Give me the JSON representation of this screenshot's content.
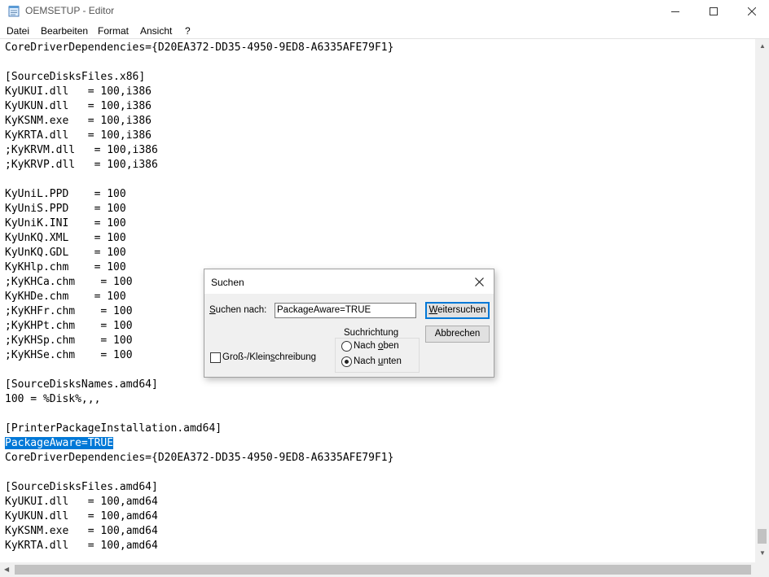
{
  "window": {
    "title": "OEMSETUP - Editor"
  },
  "menu": {
    "items": [
      "Datei",
      "Bearbeiten",
      "Format",
      "Ansicht",
      "?"
    ]
  },
  "editor": {
    "lines": [
      "CoreDriverDependencies={D20EA372-DD35-4950-9ED8-A6335AFE79F1}",
      "",
      "[SourceDisksFiles.x86]",
      "KyUKUI.dll   = 100,i386",
      "KyUKUN.dll   = 100,i386",
      "KyKSNM.exe   = 100,i386",
      "KyKRTA.dll   = 100,i386",
      ";KyKRVM.dll   = 100,i386",
      ";KyKRVP.dll   = 100,i386",
      "",
      "KyUniL.PPD    = 100",
      "KyUniS.PPD    = 100",
      "KyUniK.INI    = 100",
      "KyUnKQ.XML    = 100",
      "KyUnKQ.GDL    = 100",
      "KyKHlp.chm    = 100",
      ";KyKHCa.chm    = 100",
      "KyKHDe.chm    = 100",
      ";KyKHFr.chm    = 100",
      ";KyKHPt.chm    = 100",
      ";KyKHSp.chm    = 100",
      ";KyKHSe.chm    = 100",
      "",
      "[SourceDisksNames.amd64]",
      "100 = %Disk%,,,",
      "",
      "[PrinterPackageInstallation.amd64]",
      "PackageAware=TRUE",
      "CoreDriverDependencies={D20EA372-DD35-4950-9ED8-A6335AFE79F1}",
      "",
      "[SourceDisksFiles.amd64]",
      "KyUKUI.dll   = 100,amd64",
      "KyUKUN.dll   = 100,amd64",
      "KyKSNM.exe   = 100,amd64",
      "KyKRTA.dll   = 100,amd64"
    ],
    "selected_text": "PackageAware=TRUE",
    "selected_line_index": 27,
    "selection_color": "#0078d7"
  },
  "find_dialog": {
    "title": "Suchen",
    "search_label_prefix": "S",
    "search_label_rest": "uchen nach:",
    "search_value": "PackageAware=TRUE",
    "find_next_prefix": "W",
    "find_next_rest": "eitersuchen",
    "cancel_label": "Abbrechen",
    "direction_legend": "Suchrichtung",
    "up_label_a": "Nach ",
    "up_label_u": "o",
    "up_label_b": "ben",
    "down_label_a": "Nach ",
    "down_label_u": "u",
    "down_label_b": "nten",
    "direction_selected": "Nach unten",
    "case_label_a": "Groß-/Klein",
    "case_label_u": "s",
    "case_label_b": "chreibung",
    "case_checked": false
  }
}
